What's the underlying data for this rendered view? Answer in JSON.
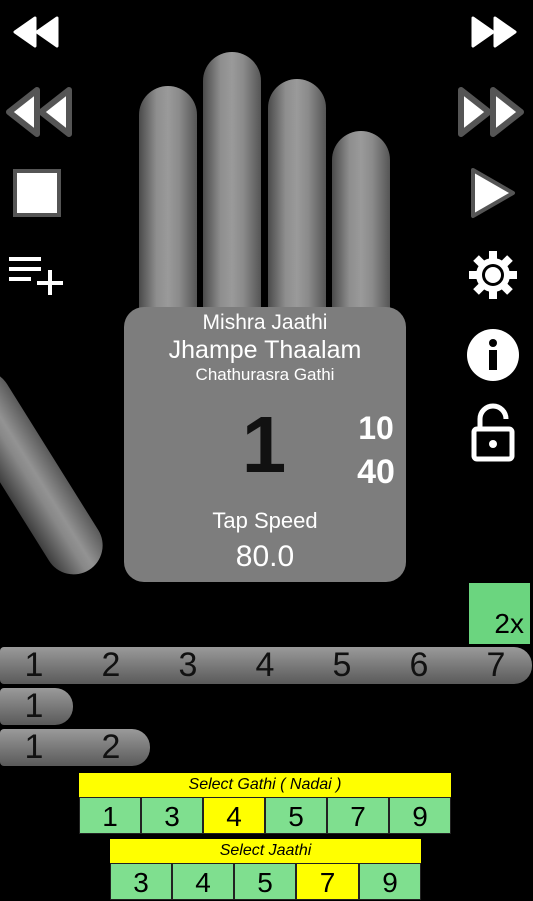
{
  "controls": {
    "left": [
      {
        "name": "skip-back-small-button",
        "icon": "rewind-small-icon"
      },
      {
        "name": "skip-back-large-button",
        "icon": "rewind-large-icon"
      },
      {
        "name": "stop-button",
        "icon": "stop-icon"
      },
      {
        "name": "playlist-add-button",
        "icon": "playlist-add-icon"
      }
    ],
    "right": [
      {
        "name": "skip-forward-small-button",
        "icon": "fast-forward-small-icon"
      },
      {
        "name": "skip-forward-large-button",
        "icon": "fast-forward-large-icon"
      },
      {
        "name": "play-button",
        "icon": "play-icon"
      },
      {
        "name": "settings-button",
        "icon": "gear-icon"
      },
      {
        "name": "info-button",
        "icon": "info-icon"
      },
      {
        "name": "lock-button",
        "icon": "unlock-icon"
      }
    ]
  },
  "palm": {
    "jaathi": "Mishra Jaathi",
    "thaalam": "Jhampe Thaalam",
    "gathi": "Chathurasra Gathi",
    "current_beat": "1",
    "count_top": "10",
    "count_bottom": "40",
    "tap_speed_label": "Tap Speed",
    "tap_speed_value": "80.0"
  },
  "speed_multiplier": "2x",
  "beat_rows": [
    [
      "1",
      "2",
      "3",
      "4",
      "5",
      "6",
      "7"
    ],
    [
      "1"
    ],
    [
      "1",
      "2"
    ]
  ],
  "gathi_selector": {
    "title": "Select Gathi ( Nadai )",
    "options": [
      "1",
      "3",
      "4",
      "5",
      "7",
      "9"
    ],
    "selected": "4"
  },
  "jaathi_selector": {
    "title": "Select Jaathi",
    "options": [
      "3",
      "4",
      "5",
      "7",
      "9"
    ],
    "selected": "7"
  },
  "colors": {
    "option_green": "#7fdf8f",
    "selected_yellow": "#ffff00",
    "multiplier_green": "#6bd57f"
  }
}
